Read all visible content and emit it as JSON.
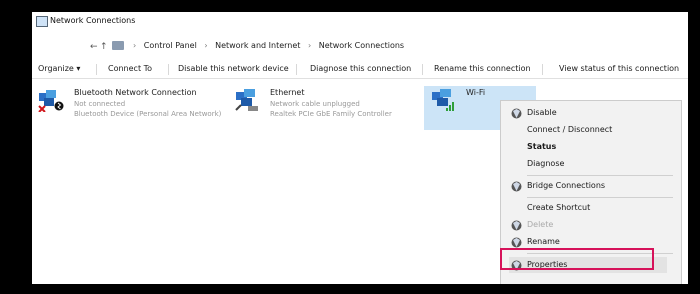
{
  "window": {
    "title": "Network Connections"
  },
  "address": {
    "nav_back": "←",
    "nav_up": "↑",
    "crumbs": [
      "Control Panel",
      "Network and Internet",
      "Network Connections"
    ]
  },
  "toolbar": {
    "organize": "Organize ▾",
    "connect_to": "Connect To",
    "disable": "Disable this network device",
    "diagnose": "Diagnose this connection",
    "rename": "Rename this connection",
    "view_status": "View status of this connection"
  },
  "connections": [
    {
      "name": "Bluetooth Network Connection",
      "status": "Not connected",
      "device": "Bluetooth Device (Personal Area Network)"
    },
    {
      "name": "Ethernet",
      "status": "Network cable unplugged",
      "device": "Realtek PCIe GbE Family Controller"
    },
    {
      "name": "Wi-Fi",
      "status": "",
      "device": ""
    }
  ],
  "context_menu": {
    "items": [
      {
        "label": "Disable",
        "shield": true,
        "bold": false
      },
      {
        "label": "Connect / Disconnect",
        "shield": false,
        "bold": false
      },
      {
        "label": "Status",
        "shield": false,
        "bold": true
      },
      {
        "label": "Diagnose",
        "shield": false,
        "bold": false
      },
      {
        "label": "Bridge Connections",
        "shield": true,
        "bold": false
      },
      {
        "label": "Create Shortcut",
        "shield": false,
        "bold": false
      },
      {
        "label": "Delete",
        "shield": true,
        "bold": false
      },
      {
        "label": "Rename",
        "shield": true,
        "bold": false
      },
      {
        "label": "Properties",
        "shield": true,
        "bold": false
      }
    ],
    "highlighted": "Properties"
  },
  "colors": {
    "highlight_border": "#d6125a",
    "selection": "#cce4f7"
  }
}
